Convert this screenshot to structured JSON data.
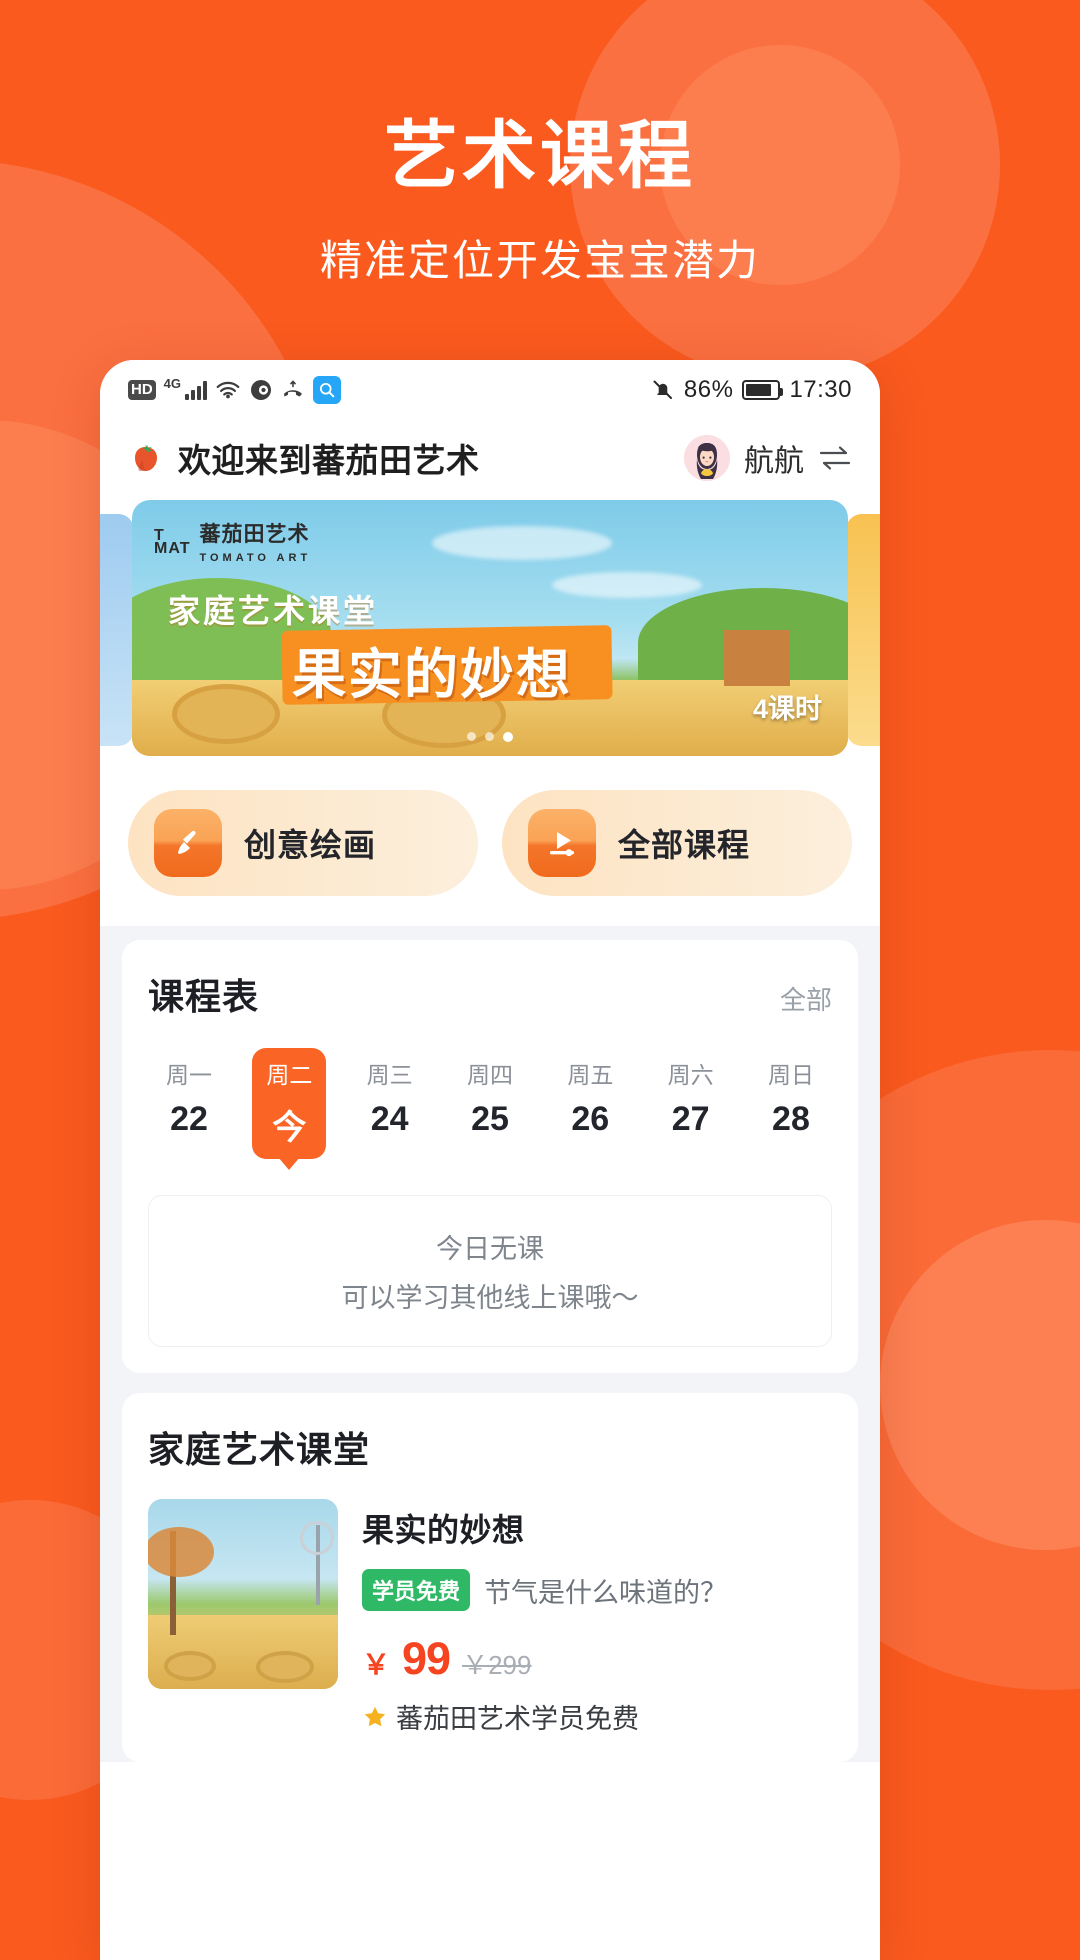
{
  "hero": {
    "title": "艺术课程",
    "subtitle": "精准定位开发宝宝潜力"
  },
  "colors": {
    "brand_orange": "#FA5A1E",
    "accent_orange": "#FA6526",
    "price_red": "#F5441F",
    "free_green": "#2FB866",
    "status_blue": "#25A6F6"
  },
  "statusbar": {
    "hd_label": "HD",
    "network_label": "4G",
    "icons": [
      "hd-icon",
      "signal-bars-icon",
      "wifi-icon",
      "eye-icon",
      "missed-call-icon",
      "search-icon"
    ],
    "mute_icon": "bell-off-icon",
    "battery_percent": "86%",
    "time": "17:30"
  },
  "appbar": {
    "logo_icon": "tomato-icon",
    "title": "欢迎来到蕃茄田艺术",
    "user_name": "航航",
    "avatar_icon": "avatar-girl-icon",
    "switch_icon": "switch-account-icon"
  },
  "banner": {
    "logo_mark": "T\nMAT",
    "logo_cn": "蕃茄田艺术",
    "logo_en": "TOMATO ART",
    "subtitle": "家庭艺术课堂",
    "main_title": "果实的妙想",
    "lessons": "4课时",
    "dots_total": 3,
    "dots_active_index": 2
  },
  "quick_entries": [
    {
      "icon": "paintbrush-icon",
      "label": "创意绘画"
    },
    {
      "icon": "video-play-icon",
      "label": "全部课程"
    }
  ],
  "schedule": {
    "title": "课程表",
    "more_label": "全部",
    "days": [
      {
        "weekday": "周一",
        "num": "22",
        "active": false
      },
      {
        "weekday": "周二",
        "num": "今",
        "active": true
      },
      {
        "weekday": "周三",
        "num": "24",
        "active": false
      },
      {
        "weekday": "周四",
        "num": "25",
        "active": false
      },
      {
        "weekday": "周五",
        "num": "26",
        "active": false
      },
      {
        "weekday": "周六",
        "num": "27",
        "active": false
      },
      {
        "weekday": "周日",
        "num": "28",
        "active": false
      }
    ],
    "empty_line1": "今日无课",
    "empty_line2": "可以学习其他线上课哦～"
  },
  "family_class": {
    "title": "家庭艺术课堂",
    "course": {
      "thumb_icon": "course-thumbnail",
      "name": "果实的妙想",
      "badge": "学员免费",
      "description": "节气是什么味道的？",
      "price_currency": "￥",
      "price_now": "99",
      "price_old": "￥299",
      "member_icon": "star-icon",
      "member_note": "蕃茄田艺术学员免费"
    }
  }
}
